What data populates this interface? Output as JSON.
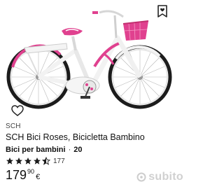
{
  "product": {
    "brand": "SCH",
    "title": "SCH Bici Roses, Bicicletta Bambino",
    "category": "Bici per bambini",
    "separator": "·",
    "size": "20",
    "rating_value": 4.5,
    "rating_count": "177",
    "price_main": "179",
    "price_cents": "90",
    "price_currency": "€"
  },
  "icons": {
    "favorite": "bookmark-heart-icon",
    "wishlist": "heart-outline-icon",
    "watermark_logo": "subito-logo"
  },
  "watermark": {
    "text": "subito"
  },
  "colors": {
    "bike_pink": "#e0418f",
    "bike_white": "#f4f4f4",
    "star": "#1a1a1a",
    "text": "#111111"
  }
}
